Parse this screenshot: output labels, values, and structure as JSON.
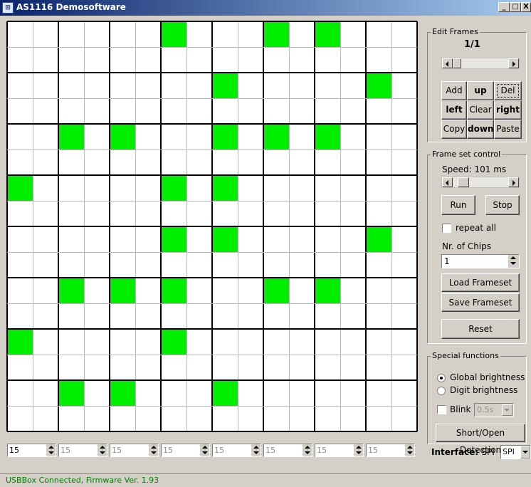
{
  "window": {
    "title": "AS1116 Demosoftware",
    "icon": "matrix-app-icon",
    "controls": [
      "_",
      "□",
      "X"
    ]
  },
  "grid": {
    "rows": 16,
    "cols": 16,
    "on_color": "#00ee00",
    "lit": [
      [
        0,
        6
      ],
      [
        0,
        10
      ],
      [
        0,
        12
      ],
      [
        2,
        8
      ],
      [
        2,
        14
      ],
      [
        4,
        2
      ],
      [
        4,
        4
      ],
      [
        4,
        8
      ],
      [
        4,
        10
      ],
      [
        4,
        12
      ],
      [
        6,
        0
      ],
      [
        6,
        6
      ],
      [
        6,
        8
      ],
      [
        8,
        6
      ],
      [
        8,
        8
      ],
      [
        8,
        14
      ],
      [
        10,
        2
      ],
      [
        10,
        4
      ],
      [
        10,
        6
      ],
      [
        10,
        10
      ],
      [
        10,
        12
      ],
      [
        12,
        0
      ],
      [
        12,
        6
      ],
      [
        14,
        2
      ],
      [
        14,
        4
      ],
      [
        14,
        8
      ]
    ]
  },
  "spinners": [
    "15",
    "15",
    "15",
    "15",
    "15",
    "15",
    "15",
    "15"
  ],
  "edit_frames": {
    "legend": "Edit Frames",
    "counter": "1/1",
    "buttons": {
      "add": "Add",
      "up": "up",
      "del": "Del",
      "left": "left",
      "clear": "Clear",
      "right": "right",
      "copy": "Copy",
      "down": "down",
      "paste": "Paste"
    }
  },
  "frame_set": {
    "legend": "Frame set control",
    "speed_label": "Speed:",
    "speed_value": "101 ms",
    "run": "Run",
    "stop": "Stop",
    "repeat_all": "repeat all",
    "chips_label": "Nr. of Chips",
    "chips_value": "1",
    "load": "Load Frameset",
    "save": "Save Frameset",
    "reset": "Reset"
  },
  "special": {
    "legend": "Special functions",
    "global": "Global brightness",
    "digit": "Digit brightness",
    "blink": "Blink",
    "blink_value": "0.5s",
    "detect": "Short/Open Detection"
  },
  "interface": {
    "label": "Interface:",
    "value": "SPI",
    "select_value": "SPI"
  },
  "status": "USBBox Connected, Firmware Ver. 1.93"
}
